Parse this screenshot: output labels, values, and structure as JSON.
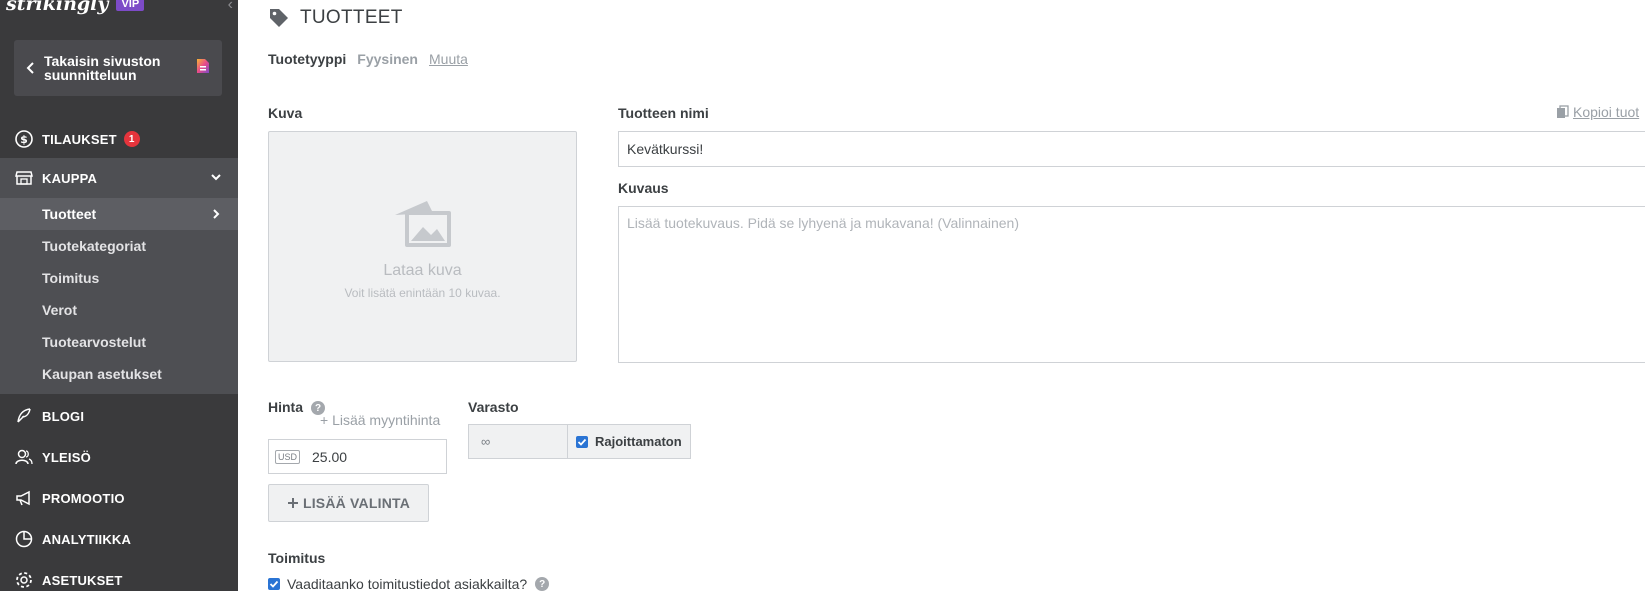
{
  "sidebar": {
    "logo": "strikingly",
    "vip_badge": "VIP",
    "back_button": "Takaisin sivuston suunnitteluun",
    "nav": {
      "orders": {
        "label": "TILAUKSET",
        "badge": "1"
      },
      "store": {
        "label": "KAUPPA"
      },
      "store_items": [
        {
          "label": "Tuotteet",
          "active": true
        },
        {
          "label": "Tuotekategoriat"
        },
        {
          "label": "Toimitus"
        },
        {
          "label": "Verot"
        },
        {
          "label": "Tuotearvostelut"
        },
        {
          "label": "Kaupan asetukset"
        }
      ],
      "blog": {
        "label": "BLOGI"
      },
      "audience": {
        "label": "YLEISÖ"
      },
      "promotion": {
        "label": "PROMOOTIO"
      },
      "analytics": {
        "label": "ANALYTIIKKA"
      },
      "settings": {
        "label": "ASETUKSET"
      }
    }
  },
  "main": {
    "title": "TUOTTEET",
    "product_type": {
      "label": "Tuotetyyppi",
      "value": "Fyysinen",
      "change": "Muuta"
    },
    "image": {
      "label": "Kuva",
      "upload": "Lataa kuva",
      "hint": "Voit lisätä enintään 10 kuvaa."
    },
    "product_name": {
      "label": "Tuotteen nimi",
      "value": "Kevätkurssi!",
      "copy_link": "Kopioi tuot"
    },
    "description": {
      "label": "Kuvaus",
      "placeholder": "Lisää tuotekuvaus. Pidä se lyhyenä ja mukavana! (Valinnainen)"
    },
    "price": {
      "label": "Hinta",
      "add_sale": "+ Lisää myyntihinta",
      "currency": "USD",
      "value": "25.00"
    },
    "stock": {
      "label": "Varasto",
      "value": "∞",
      "unlimited": "Rajoittamaton",
      "unlimited_checked": true
    },
    "add_option": "LISÄÄ VALINTA",
    "shipping": {
      "label": "Toimitus",
      "question": "Vaaditaanko toimitustiedot asiakkailta?",
      "checked": true
    }
  },
  "colors": {
    "sidebar_bg": "#3a3a3c",
    "sidebar_active": "#4e4f53",
    "badge": "#e5343c",
    "vip": "#7d4bc8",
    "checkbox": "#2a74d4"
  }
}
